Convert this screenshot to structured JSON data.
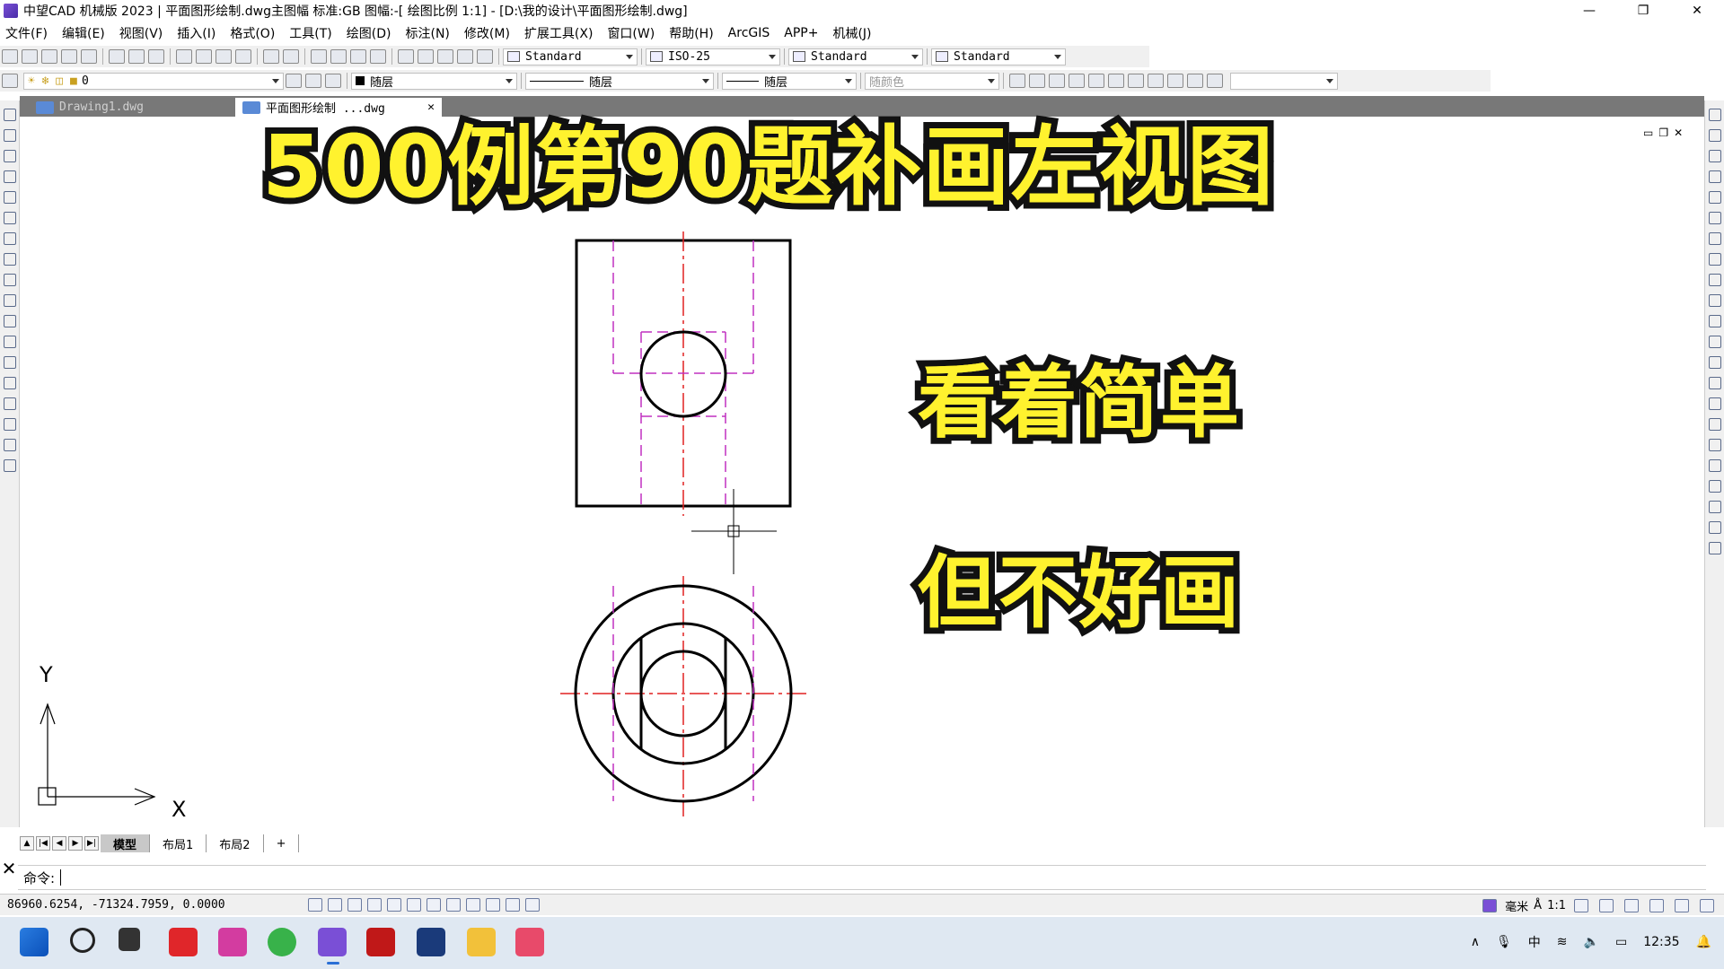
{
  "window": {
    "title": "中望CAD 机械版 2023 | 平面图形绘制.dwg主图幅  标准:GB 图幅:-[ 绘图比例 1:1] - [D:\\我的设计\\平面图形绘制.dwg]",
    "min": "—",
    "max": "❐",
    "close": "✕"
  },
  "menu": [
    "文件(F)",
    "编辑(E)",
    "视图(V)",
    "插入(I)",
    "格式(O)",
    "工具(T)",
    "绘图(D)",
    "标注(N)",
    "修改(M)",
    "扩展工具(X)",
    "窗口(W)",
    "帮助(H)",
    "ArcGIS",
    "APP+",
    "机械(J)"
  ],
  "toolbar1": {
    "text_style": "Standard",
    "dim_style": "ISO-25",
    "table_style": "Standard",
    "mleader_style": "Standard"
  },
  "toolbar2": {
    "layer": "0",
    "color": "随层",
    "linetype": "随层",
    "lineweight": "随层",
    "plotstyle": "随颜色"
  },
  "doc_tabs": [
    {
      "label": "Drawing1.dwg",
      "active": false
    },
    {
      "label": "平面图形绘制 ...dwg",
      "active": true
    }
  ],
  "overlay": {
    "title": "500例第90题补画左视图",
    "line1": "看着简单",
    "line2": "但不好画"
  },
  "ucs": {
    "x": "X",
    "y": "Y"
  },
  "layout_tabs": [
    {
      "label": "模型",
      "active": true
    },
    {
      "label": "布局1",
      "active": false
    },
    {
      "label": "布局2",
      "active": false
    },
    {
      "label": "+",
      "active": false
    }
  ],
  "command": {
    "prompt": "命令:"
  },
  "status": {
    "coords": "86960.6254, -71324.7959, 0.0000",
    "units": "毫米",
    "scale": "1:1"
  },
  "tray": {
    "ime": "中",
    "time": "12:35"
  },
  "colors": {
    "overlay_yellow": "#fff22e",
    "center_line": "#e02020",
    "hidden_line": "#c030c0",
    "taskbar": "#dfe8f2"
  }
}
